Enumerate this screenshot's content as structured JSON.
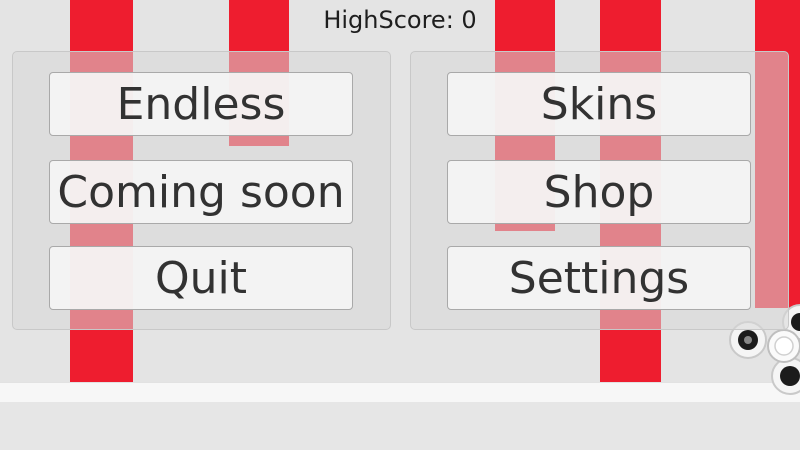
{
  "highscore": {
    "label": "HighScore: 0"
  },
  "left_menu": {
    "endless": "Endless",
    "coming_soon": "Coming soon",
    "quit": "Quit"
  },
  "right_menu": {
    "skins": "Skins",
    "shop": "Shop",
    "settings": "Settings"
  },
  "colors": {
    "pillar_red": "#ee1d2f",
    "background": "#e4e4e4"
  }
}
